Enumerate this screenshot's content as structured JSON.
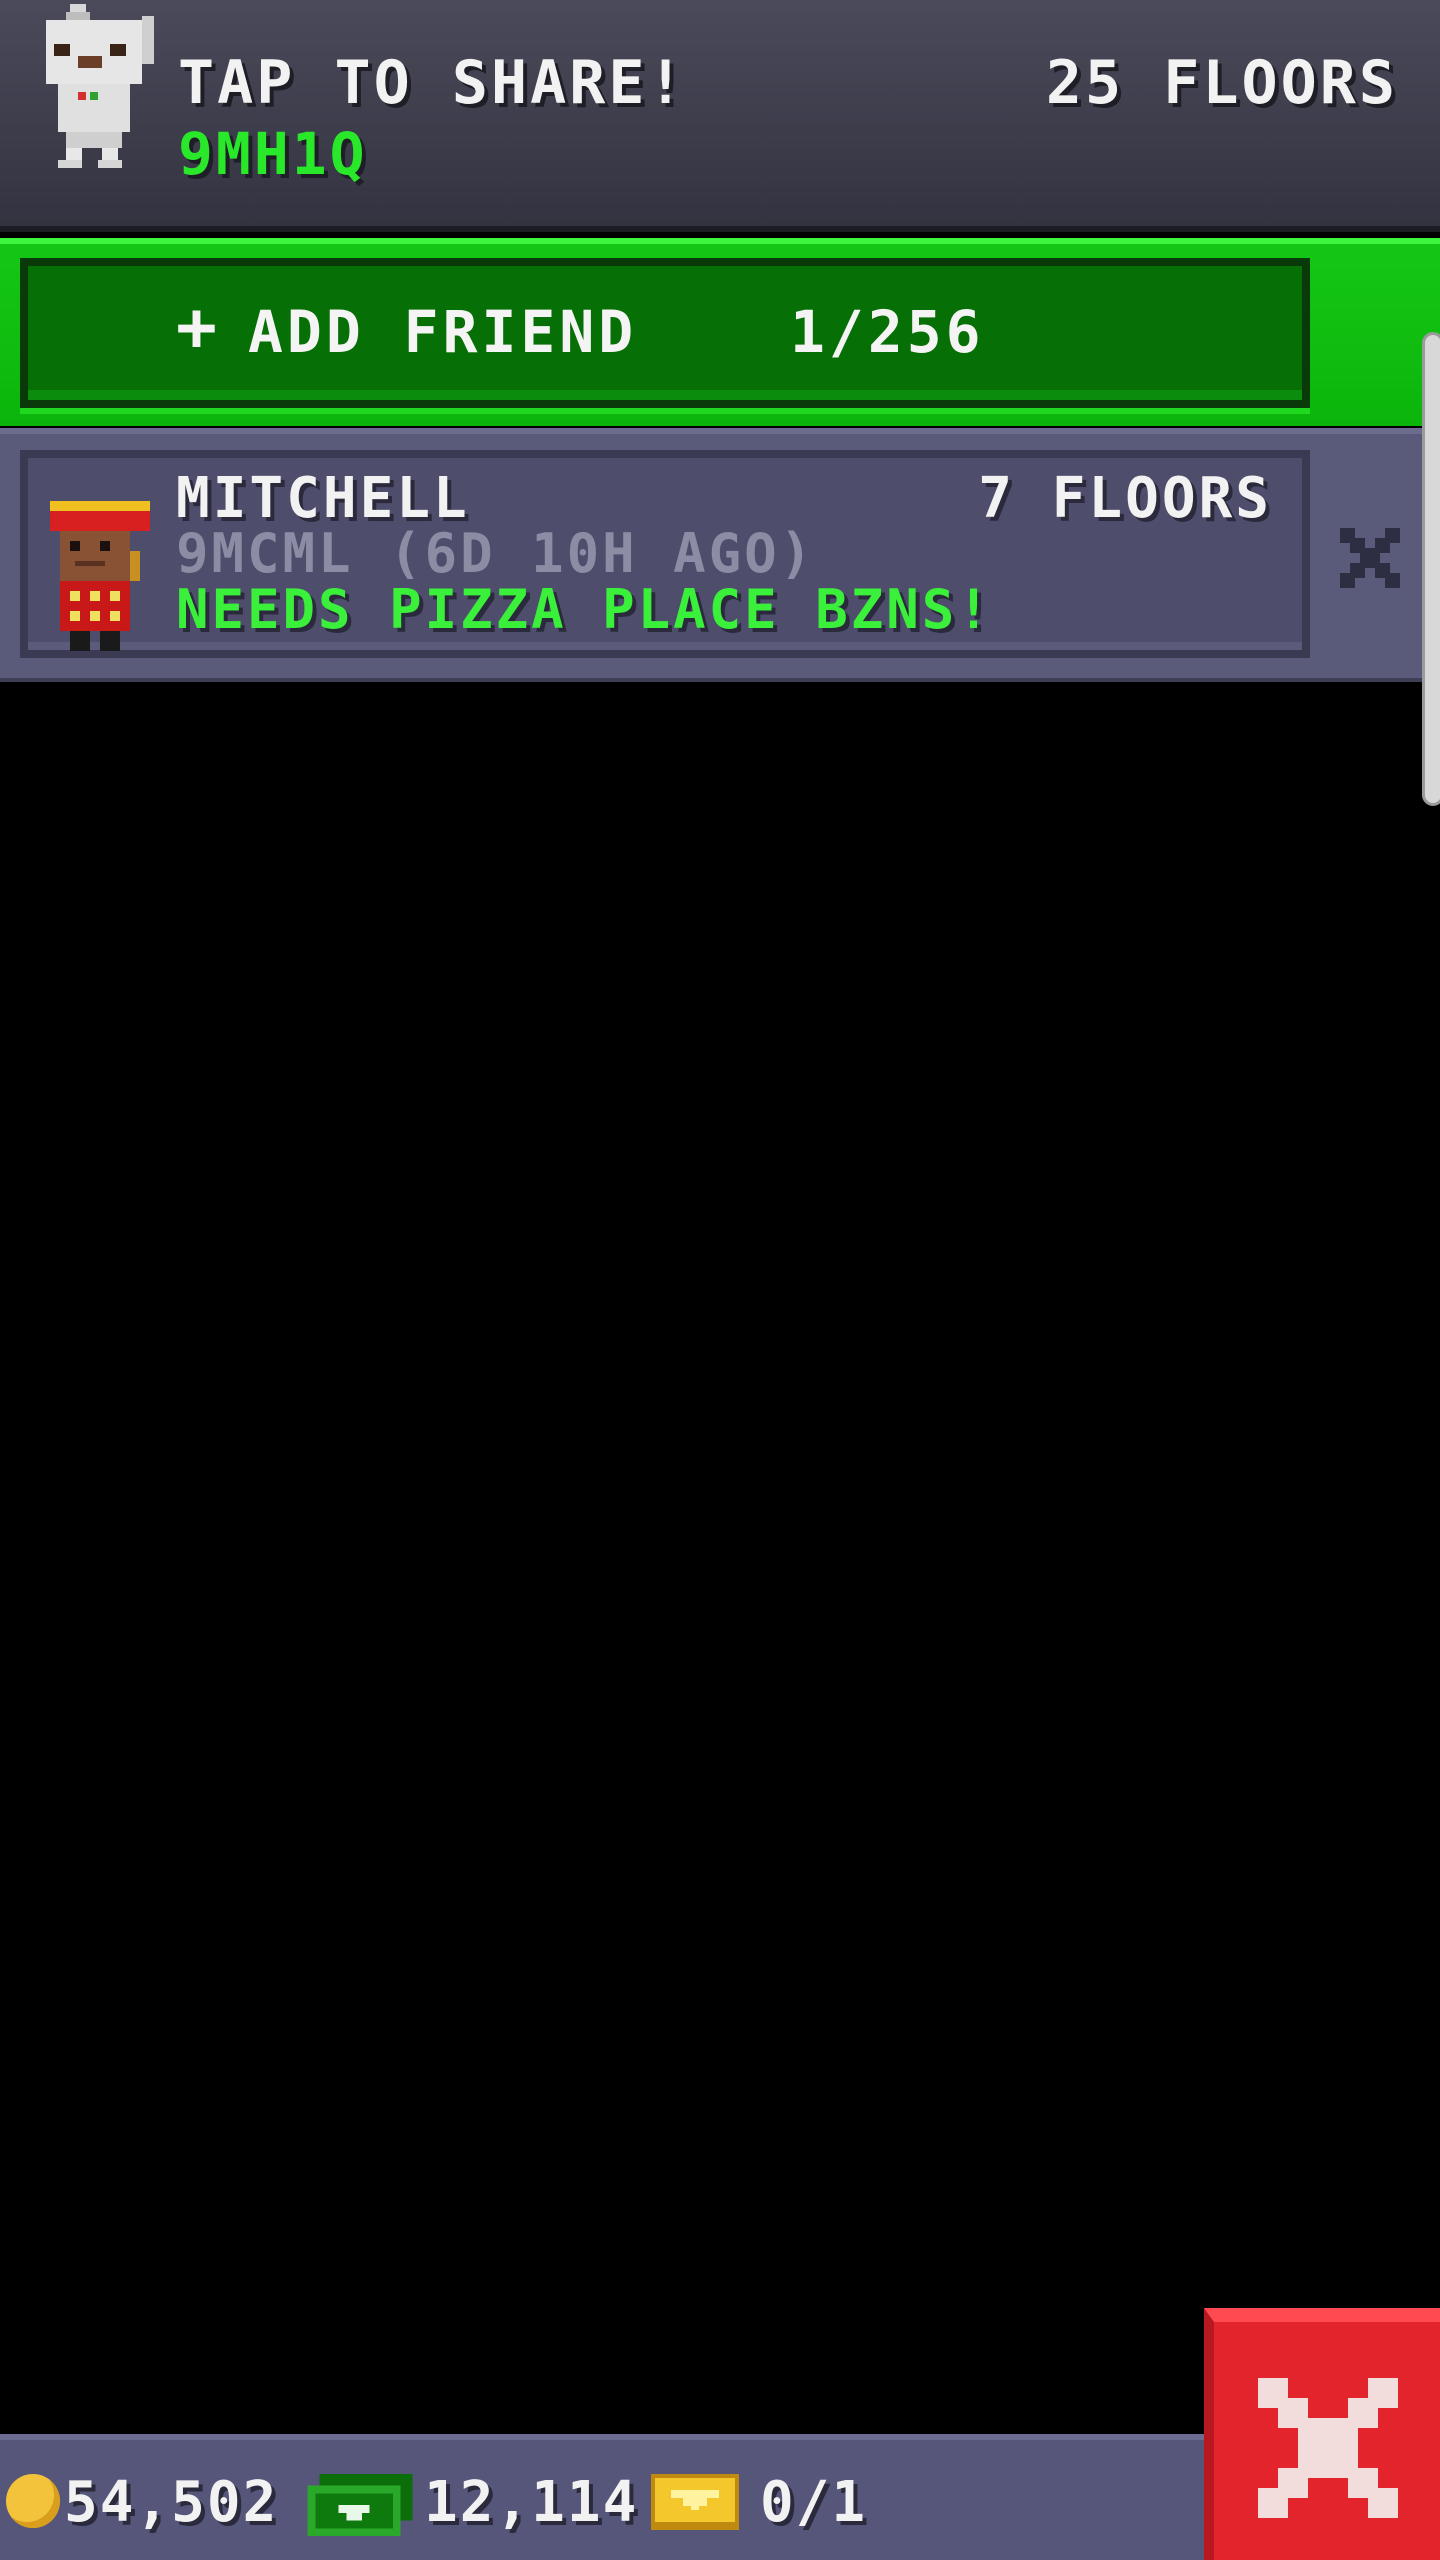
{
  "header": {
    "share_label": "TAP TO SHARE!",
    "player_code": "9MH1Q",
    "floors": "25 FLOORS",
    "avatar_icon": "robot-avatar-icon"
  },
  "add_friend": {
    "plus": "+",
    "label": "ADD FRIEND",
    "count": "1/256"
  },
  "friends": [
    {
      "name": "MITCHELL",
      "floors": "7 FLOORS",
      "code": "9MCML (6D 10H AGO)",
      "status": "NEEDS PIZZA PLACE BZNS!",
      "avatar_icon": "bellhop-avatar-icon",
      "remove_icon": "x-icon"
    }
  ],
  "currency": {
    "coins": "54,502",
    "bux": "12,114",
    "tickets": "0/1"
  },
  "colors": {
    "accent_green": "#29e829",
    "close_red": "#e4242c",
    "panel": "#56567a"
  }
}
